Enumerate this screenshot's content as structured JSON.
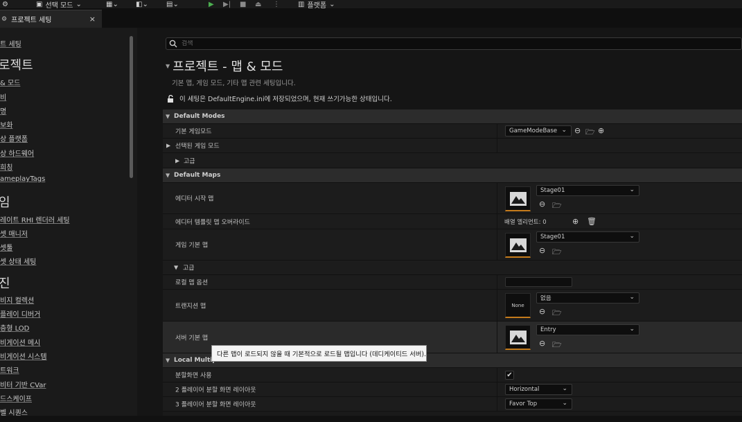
{
  "toolbar": {
    "select_mode": "선택 모드",
    "platforms": "플랫폼"
  },
  "tab": {
    "label": "프로젝트 세팅",
    "close": "×"
  },
  "sidebar": {
    "items": [
      {
        "label": "트 세팅",
        "kind": "link"
      },
      {
        "label": "로젝트",
        "kind": "head"
      },
      {
        "label": "& 모드",
        "kind": "link"
      },
      {
        "label": "비",
        "kind": "link"
      },
      {
        "label": "명",
        "kind": "link"
      },
      {
        "label": "보화",
        "kind": "link"
      },
      {
        "label": "상 플랫폼",
        "kind": "link"
      },
      {
        "label": "상 하드웨어",
        "kind": "link"
      },
      {
        "label": "희칭",
        "kind": "link"
      },
      {
        "label": "ameplayTags",
        "kind": "link"
      },
      {
        "label": "임",
        "kind": "head"
      },
      {
        "label": "레이트 RHI 렌더러 세팅",
        "kind": "link"
      },
      {
        "label": "셋 매니저",
        "kind": "link"
      },
      {
        "label": "셋툴",
        "kind": "link"
      },
      {
        "label": "셋 상태 세팅",
        "kind": "link"
      },
      {
        "label": "진",
        "kind": "head"
      },
      {
        "label": "비지 컬렉션",
        "kind": "link"
      },
      {
        "label": "플레이 디버거",
        "kind": "link"
      },
      {
        "label": "층형 LOD",
        "kind": "link"
      },
      {
        "label": "비게이션 메시",
        "kind": "link"
      },
      {
        "label": "비게이션 시스템",
        "kind": "link"
      },
      {
        "label": "트워크",
        "kind": "link"
      },
      {
        "label": "비터 기반 CVar",
        "kind": "link"
      },
      {
        "label": "드스케이프",
        "kind": "link"
      },
      {
        "label": "벨 시퀀스",
        "kind": "link"
      }
    ]
  },
  "search": {
    "placeholder": "검색"
  },
  "page": {
    "title": "프로젝트 - 맵 & 모드",
    "subtitle": "기본 맵, 게임 모드, 기타 맵 관련 세팅입니다.",
    "saved_note": "이 세팅은 DefaultEngine.ini에 저장되었으며, 현재 쓰기가능한 상태입니다."
  },
  "sections": {
    "default_modes": {
      "label": "Default Modes",
      "default_game_mode_label": "기본 게임모드",
      "default_game_mode_value": "GameModeBase",
      "selected_game_mode_label": "선택된 게임 모드",
      "advanced_label": "고급"
    },
    "default_maps": {
      "label": "Default Maps",
      "editor_startup_map_label": "에디터 시작 맵",
      "editor_startup_map_value": "Stage01",
      "editor_template_override_label": "에디터 템플릿 맵 오버라이드",
      "array_elements_label": "배열 엘리먼트: 0",
      "game_default_map_label": "게임 기본 맵",
      "game_default_map_value": "Stage01",
      "advanced_label": "고급",
      "local_map_options_label": "로컬 맵 옵션",
      "transition_map_label": "트랜지션 맵",
      "transition_map_value": "없음",
      "transition_thumb_text": "None",
      "server_default_map_label": "서버 기본 맵",
      "server_default_map_value": "Entry"
    },
    "local_multiplayer": {
      "label": "Local Multipl",
      "split_screen_label": "분할화면 사용",
      "two_player_layout_label": "2 플레이어 분할 화면 레이아웃",
      "two_player_layout_value": "Horizontal",
      "three_player_layout_label": "3 플레이어 분할 화면 레이아웃",
      "three_player_layout_value": "Favor Top"
    }
  },
  "tooltip": {
    "text": "다른 맵이 로드되지 않을 때 기본적으로 로드될 맵입니다 (데디케이티드 서버)."
  },
  "colors": {
    "accent": "#c57b1b",
    "background": "#151515",
    "panel": "#1a1a1a",
    "tooltip_bg": "#f4f4f4"
  }
}
